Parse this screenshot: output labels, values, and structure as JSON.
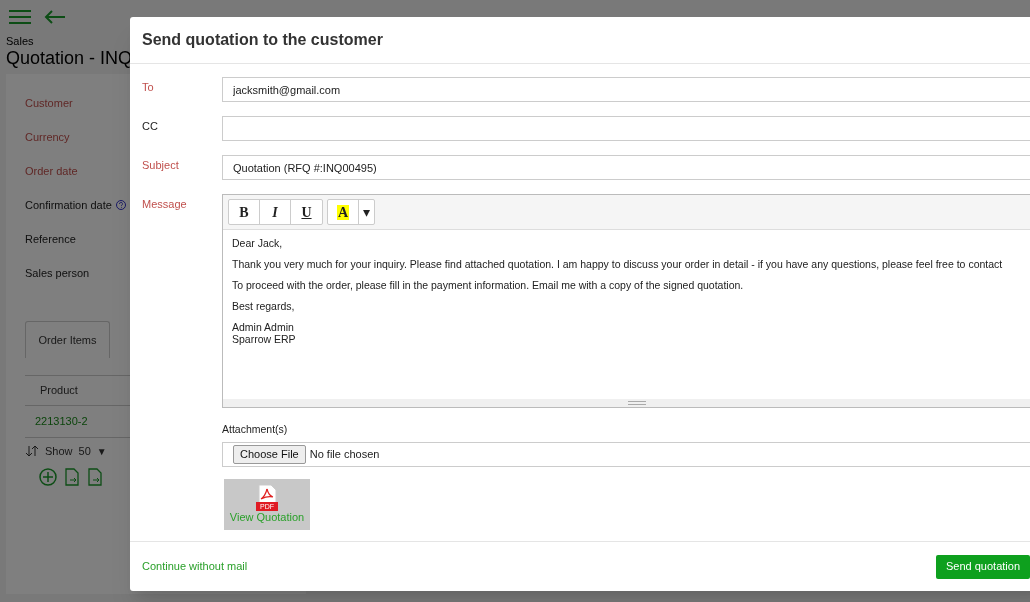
{
  "page": {
    "breadcrumb": "Sales",
    "title": "Quotation - INQ",
    "fields": [
      {
        "label": "Customer",
        "required": true
      },
      {
        "label": "Currency",
        "required": true
      },
      {
        "label": "Order date",
        "required": true
      },
      {
        "label": "Confirmation date",
        "required": false,
        "help": true
      },
      {
        "label": "Reference",
        "required": false
      },
      {
        "label": "Sales person",
        "required": false
      }
    ],
    "tabs": [
      {
        "label": "Order Items",
        "selected": true
      }
    ],
    "table": {
      "columns": [
        "Product"
      ],
      "rows": [
        [
          "2213130-2"
        ]
      ]
    },
    "pager": {
      "label": "Show",
      "page_size": "50",
      "caret": "▼"
    }
  },
  "dialog": {
    "title": "Send quotation to the customer",
    "fields": [
      {
        "label": "To",
        "required": true,
        "value": "jacksmith@gmail.com"
      },
      {
        "label": "CC",
        "required": false
      },
      {
        "label": "Subject",
        "required": true,
        "value": "Quotation (RFQ #:INQ00495)"
      }
    ],
    "message": {
      "label": "Message",
      "required": true,
      "toolbar": [
        {
          "kind": "bold",
          "text": "B"
        },
        {
          "kind": "italic",
          "text": "I"
        },
        {
          "kind": "underline",
          "text": "U"
        },
        {
          "kind": "highlight",
          "text": "A"
        },
        {
          "kind": "dropdown",
          "text": "▾"
        }
      ],
      "paragraphs": [
        [
          "Dear Jack,"
        ],
        [
          "Thank you very much for your inquiry. Please find attached quotation. I am happy to discuss your order in detail - if you have any questions, please feel free to contact"
        ],
        [
          "To proceed with the order, please fill in the payment information. Email me with a copy of the signed quotation."
        ],
        [
          "Best regards,"
        ],
        [
          "Admin Admin",
          "Sparrow ERP"
        ]
      ]
    },
    "attachments": {
      "label": "Attachment(s)",
      "button": "Choose File",
      "status": "No file chosen"
    },
    "attachment_tile": {
      "badge": "PDF",
      "label": "View Quotation"
    },
    "footer": {
      "link": "Continue without mail",
      "button": "Send quotation"
    }
  }
}
